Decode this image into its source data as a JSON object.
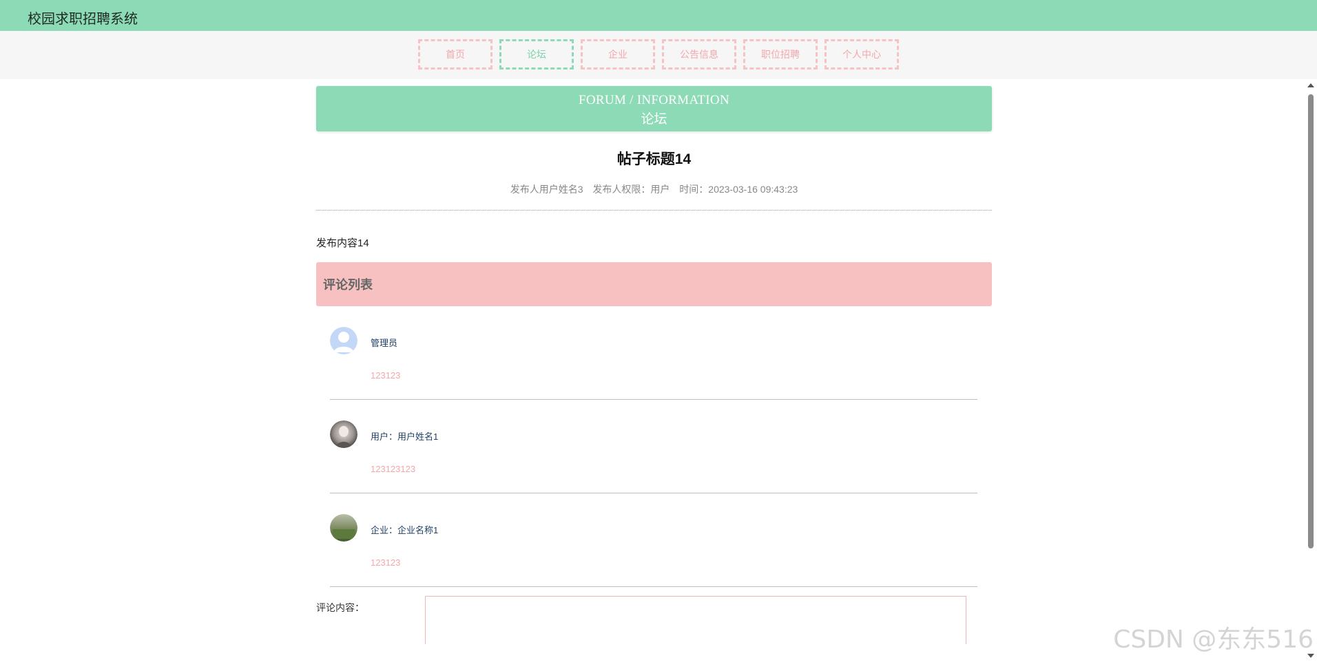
{
  "app": {
    "title": "校园求职招聘系统"
  },
  "nav": {
    "items": [
      {
        "label": "首页"
      },
      {
        "label": "论坛"
      },
      {
        "label": "企业"
      },
      {
        "label": "公告信息"
      },
      {
        "label": "职位招聘"
      },
      {
        "label": "个人中心"
      }
    ],
    "active": "论坛"
  },
  "banner": {
    "en": "FORUM / INFORMATION",
    "cn": "论坛"
  },
  "post": {
    "title": "帖子标题14",
    "author": "发布人用户姓名3",
    "role": "发布人权限：用户",
    "time": "时间：2023-03-16 09:43:23",
    "content": "发布内容14"
  },
  "comments": {
    "header": "评论列表",
    "items": [
      {
        "name": "管理员",
        "text": "123123",
        "avatar_icon": "default-user-avatar-icon"
      },
      {
        "name": "用户：用户姓名1",
        "text": "123123123",
        "avatar_icon": "user-photo-avatar"
      },
      {
        "name": "企业：企业名称1",
        "text": "123123",
        "avatar_icon": "company-photo-avatar"
      }
    ]
  },
  "form": {
    "label": "评论内容：",
    "value": ""
  },
  "watermark": "CSDN @东东516",
  "colors": {
    "brand": "#8ddbb6",
    "accent_pink": "#f7c1c2",
    "nav_text": "#f3a7ab"
  }
}
